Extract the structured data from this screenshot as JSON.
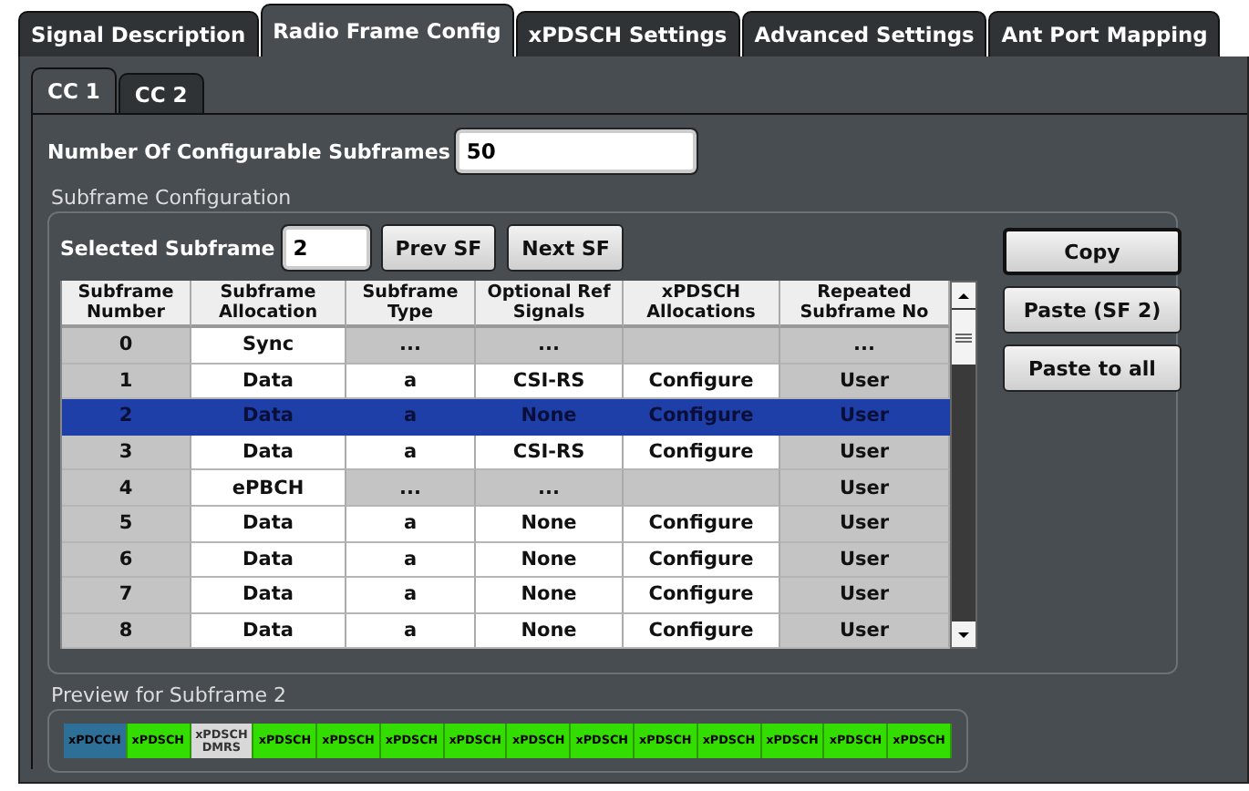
{
  "tabs": [
    {
      "label": "Signal Description",
      "selected": false
    },
    {
      "label": "Radio Frame Config",
      "selected": true
    },
    {
      "label": "xPDSCH Settings",
      "selected": false
    },
    {
      "label": "Advanced Settings",
      "selected": false
    },
    {
      "label": "Ant Port Mapping",
      "selected": false
    }
  ],
  "cc_tabs": [
    {
      "label": "CC 1",
      "selected": true
    },
    {
      "label": "CC 2",
      "selected": false
    }
  ],
  "configurable_subframes": {
    "label": "Number Of Configurable Subframes",
    "value": "50"
  },
  "subframe_configuration": {
    "title": "Subframe Configuration",
    "selected_subframe": {
      "label": "Selected Subframe",
      "value": "2"
    },
    "nav_buttons": [
      "Prev SF",
      "Next SF"
    ],
    "side_buttons": [
      "Copy",
      "Paste (SF 2)",
      "Paste to all"
    ],
    "table": {
      "columns": [
        "Subframe Number",
        "Subframe Allocation",
        "Subframe Type",
        "Optional Ref Signals",
        "xPDSCH Allocations",
        "Repeated Subframe No"
      ],
      "rows": [
        {
          "kind": "special",
          "selected": false,
          "cells": [
            "0",
            "Sync",
            "...",
            "...",
            null,
            "..."
          ]
        },
        {
          "kind": "data",
          "selected": false,
          "cells": [
            "1",
            "Data",
            "a",
            "CSI-RS",
            "Configure",
            "User"
          ]
        },
        {
          "kind": "data",
          "selected": true,
          "cells": [
            "2",
            "Data",
            "a",
            "None",
            "Configure",
            "User"
          ]
        },
        {
          "kind": "data",
          "selected": false,
          "cells": [
            "3",
            "Data",
            "a",
            "CSI-RS",
            "Configure",
            "User"
          ]
        },
        {
          "kind": "special",
          "selected": false,
          "cells": [
            "4",
            "ePBCH",
            "...",
            "...",
            null,
            "User"
          ]
        },
        {
          "kind": "data",
          "selected": false,
          "cells": [
            "5",
            "Data",
            "a",
            "None",
            "Configure",
            "User"
          ]
        },
        {
          "kind": "data",
          "selected": false,
          "cells": [
            "6",
            "Data",
            "a",
            "None",
            "Configure",
            "User"
          ]
        },
        {
          "kind": "data",
          "selected": false,
          "cells": [
            "7",
            "Data",
            "a",
            "None",
            "Configure",
            "User"
          ]
        },
        {
          "kind": "data",
          "selected": false,
          "cells": [
            "8",
            "Data",
            "a",
            "None",
            "Configure",
            "User"
          ]
        }
      ]
    }
  },
  "preview": {
    "title": "Preview for Subframe 2",
    "segments": [
      {
        "kind": "control",
        "label": "xPDCCH"
      },
      {
        "kind": "data",
        "label": "xPDSCH"
      },
      {
        "kind": "dmrs",
        "label": "xPDSCH DMRS"
      },
      {
        "kind": "data",
        "label": "xPDSCH"
      },
      {
        "kind": "data",
        "label": "xPDSCH"
      },
      {
        "kind": "data",
        "label": "xPDSCH"
      },
      {
        "kind": "data",
        "label": "xPDSCH"
      },
      {
        "kind": "data",
        "label": "xPDSCH"
      },
      {
        "kind": "data",
        "label": "xPDSCH"
      },
      {
        "kind": "data",
        "label": "xPDSCH"
      },
      {
        "kind": "data",
        "label": "xPDSCH"
      },
      {
        "kind": "data",
        "label": "xPDSCH"
      },
      {
        "kind": "data",
        "label": "xPDSCH"
      },
      {
        "kind": "data",
        "label": "xPDSCH"
      }
    ]
  }
}
